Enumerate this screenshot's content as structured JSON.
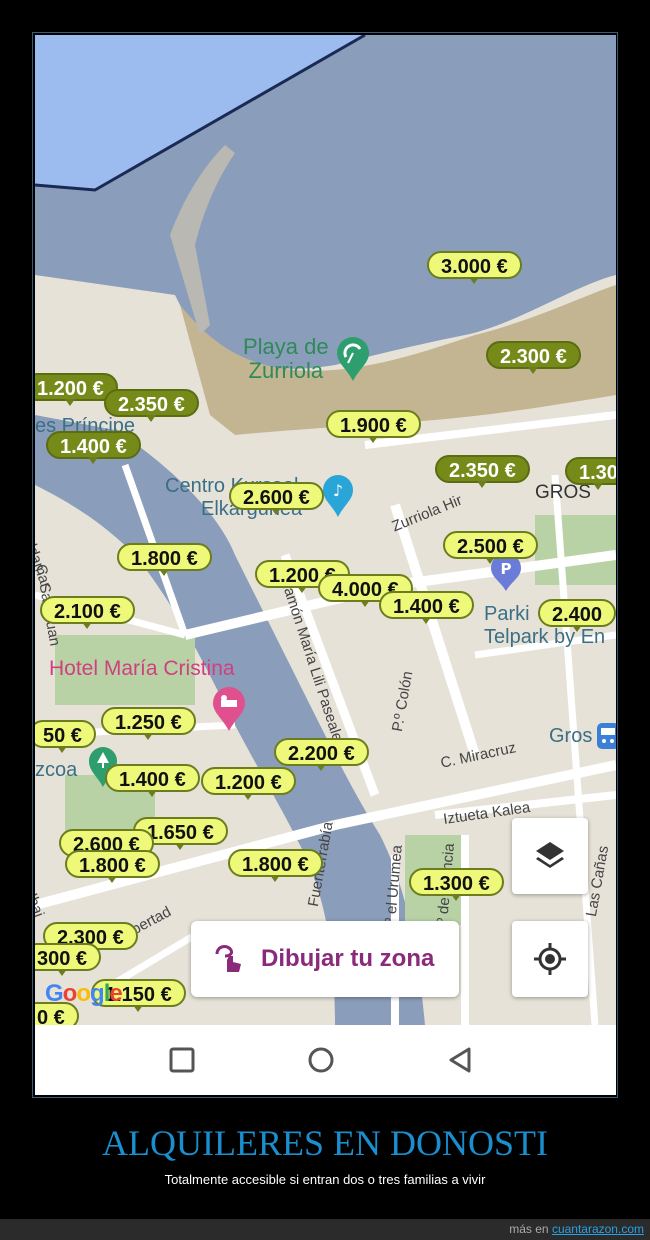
{
  "map": {
    "labels": {
      "playa_line1": "Playa de",
      "playa_line2": "Zurriola",
      "principe": "es Príncipe",
      "centro_line1": "Centro Kursaal",
      "centro_line2": "Elkargunea",
      "zurriola_hiribidea": "Zurriola Hir",
      "gros": "GROS",
      "aldamar": "C. Aldamar",
      "san_juan": "C. San Juan",
      "parking_line1": "Parki",
      "parking_line2": "Telpark by En",
      "hotel": "Hotel María Cristina",
      "ramon": "Ramón María Lili Pasealekua",
      "colon": "P.º Colón",
      "miracruz": "C. Miracruz",
      "gros_station": "Gros",
      "iztueta": "Iztueta Kalea",
      "gipuzkoa": "zcoa",
      "libertad": "Libertad",
      "fuenterrabia": "Fuenterrabía",
      "urumea": "P.º el Urumea",
      "francia": "P.º de Francia",
      "ibai": "Ibai",
      "las_canas": "Las Cañas"
    },
    "prices": [
      {
        "label": "3.000 €",
        "style": "light"
      },
      {
        "label": "2.300 €",
        "style": "olive"
      },
      {
        "label": "1.200 €",
        "style": "olive"
      },
      {
        "label": "2.350 €",
        "style": "olive"
      },
      {
        "label": "1.400 €",
        "style": "olive"
      },
      {
        "label": "1.900 €",
        "style": "light"
      },
      {
        "label": "2.350 €",
        "style": "olive"
      },
      {
        "label": "1.30",
        "style": "olive"
      },
      {
        "label": "2.600 €",
        "style": "light"
      },
      {
        "label": "2.500 €",
        "style": "light"
      },
      {
        "label": "1.800 €",
        "style": "light"
      },
      {
        "label": "1.200 €",
        "style": "light"
      },
      {
        "label": "4.000 €",
        "style": "light"
      },
      {
        "label": "1.400 €",
        "style": "light"
      },
      {
        "label": "2.400",
        "style": "light"
      },
      {
        "label": "2.100 €",
        "style": "light"
      },
      {
        "label": "50 €",
        "style": "light"
      },
      {
        "label": "1.250 €",
        "style": "light"
      },
      {
        "label": "2.200 €",
        "style": "light"
      },
      {
        "label": "1.400 €",
        "style": "light"
      },
      {
        "label": "1.200 €",
        "style": "light"
      },
      {
        "label": "1.650 €",
        "style": "light"
      },
      {
        "label": "2.600 €",
        "style": "light"
      },
      {
        "label": "1.800 €",
        "style": "light"
      },
      {
        "label": "1.800 €",
        "style": "light"
      },
      {
        "label": "1.300 €",
        "style": "light"
      },
      {
        "label": "2.300 €",
        "style": "light"
      },
      {
        "label": "300 €",
        "style": "light"
      },
      {
        "label": "1.150 €",
        "style": "light"
      },
      {
        "label": "0 €",
        "style": "light"
      }
    ],
    "google_logo": "Google"
  },
  "controls": {
    "layers_icon": "layers-icon",
    "locate_icon": "my-location-icon",
    "draw_icon": "draw-hand-icon",
    "draw_label": "Dibujar tu zona"
  },
  "navbar": {
    "recents_icon": "square-icon",
    "home_icon": "circle-icon",
    "back_icon": "triangle-back-icon"
  },
  "caption": {
    "title": "ALQUILERES EN DONOSTI",
    "subtitle": "Totalmente accesible si entran dos o tres familias a vivir"
  },
  "footer": {
    "prefix": "más en",
    "site": "cuantarazon.com"
  },
  "colors": {
    "sea": "#8a9dba",
    "beach": "#c3b592",
    "river": "#8a9dba",
    "price_light": "#eef97a",
    "price_olive": "#768a1a",
    "caption_blue": "#1a8fd0"
  }
}
